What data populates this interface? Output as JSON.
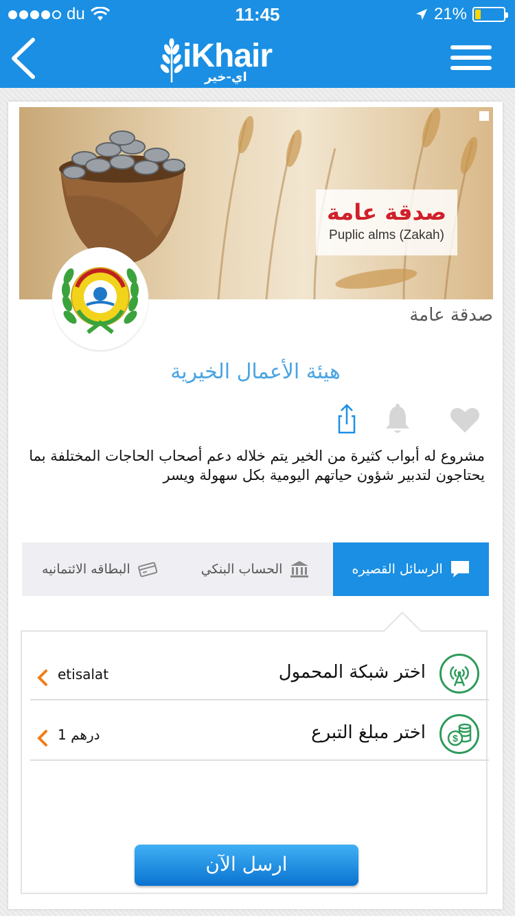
{
  "status_bar": {
    "carrier": "du",
    "time": "11:45",
    "battery": "21%",
    "battery_level": 0.21
  },
  "header": {
    "logo_text": "iKhair",
    "logo_sub": "اي-خير"
  },
  "banner": {
    "title_ar": "صدقة عامة",
    "title_en": "Puplic alms (Zakah)",
    "org_logo_ring_text": "HUMAN APPEAL INT."
  },
  "project": {
    "type": "صدقة عامة",
    "org_name": "هيئة الأعمال الخيرية",
    "description": "مشروع له أبواب كثيرة من الخير يتم خلاله دعم أصحاب الحاجات المختلفة بما يحتاجون لتدبير شؤون حياتهم اليومية بكل سهولة ويسر"
  },
  "tabs": [
    {
      "label": "الرسائل القصيره",
      "icon": "chat-icon",
      "active": true
    },
    {
      "label": "الحساب البنكي",
      "icon": "bank-icon",
      "active": false
    },
    {
      "label": "البطاقه الائتمانيه",
      "icon": "credit-card-icon",
      "active": false
    }
  ],
  "form": {
    "network_label": "اختر شبكة المحمول",
    "network_value": "etisalat",
    "amount_label": "اختر مبلغ التبرع",
    "amount_value": "1 درهم",
    "send_label": "ارسل الآن"
  },
  "colors": {
    "brand_blue": "#1a8fe3",
    "accent_orange": "#f07d1a",
    "icon_green": "#2e9a5a",
    "org_name_blue": "#4aa4e2"
  }
}
